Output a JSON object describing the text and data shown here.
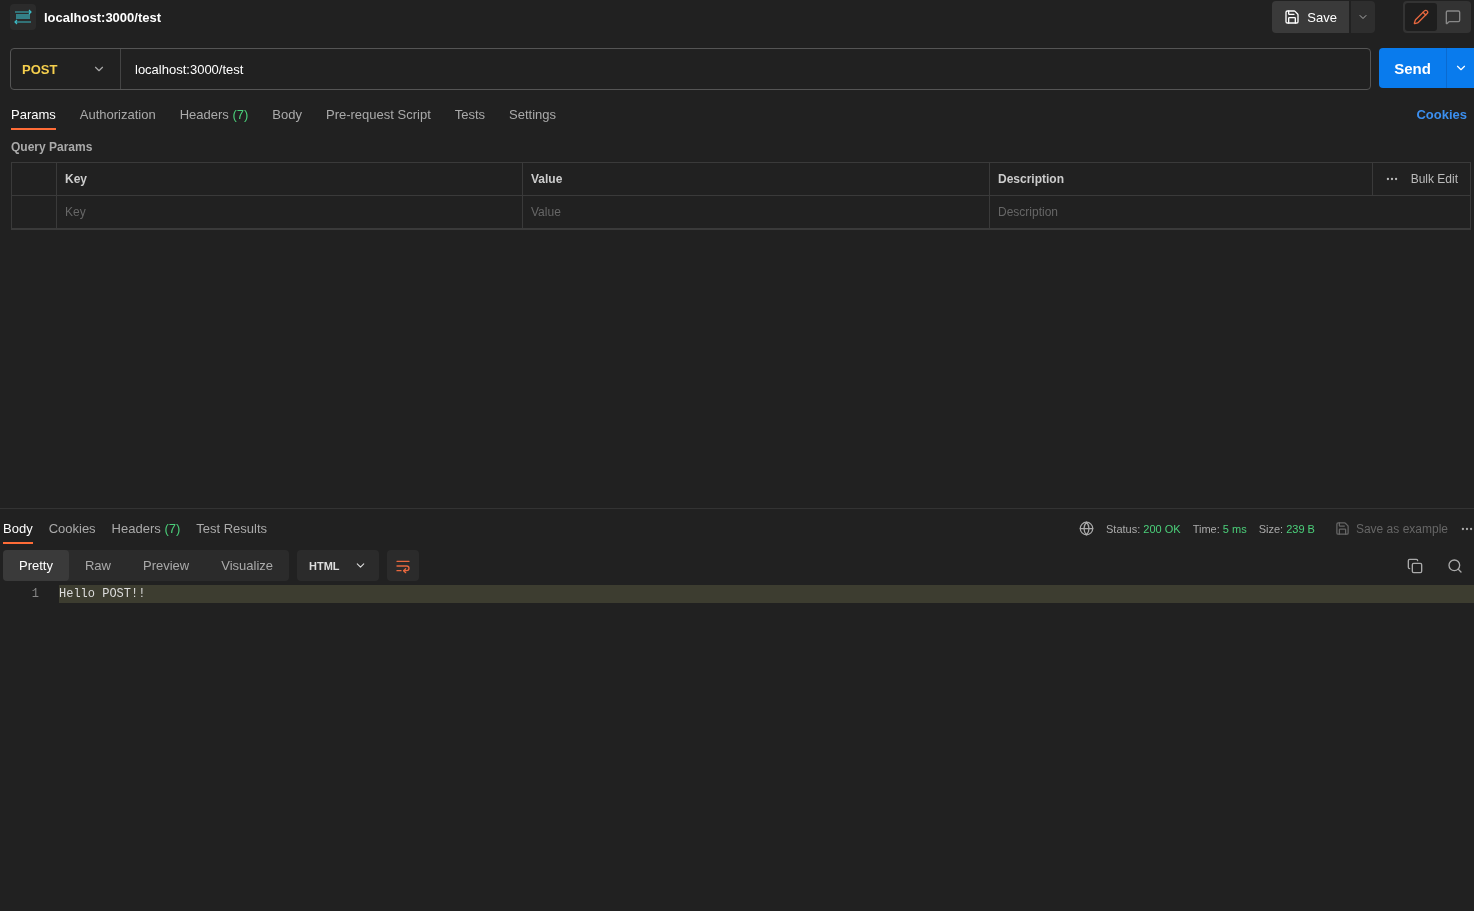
{
  "header": {
    "title": "localhost:3000/test",
    "save_label": "Save",
    "mode_toggle": [
      {
        "kind": "edit",
        "selected": true
      },
      {
        "kind": "comment",
        "selected": false
      }
    ]
  },
  "url_bar": {
    "method": "POST",
    "url": "localhost:3000/test",
    "send_label": "Send"
  },
  "request_tabs": [
    {
      "label": "Params",
      "selected": true
    },
    {
      "label": "Authorization",
      "selected": false
    },
    {
      "label": "Headers",
      "badge": "(7)",
      "selected": false
    },
    {
      "label": "Body",
      "selected": false
    },
    {
      "label": "Pre-request Script",
      "selected": false
    },
    {
      "label": "Tests",
      "selected": false
    },
    {
      "label": "Settings",
      "selected": false
    }
  ],
  "cookies_link": "Cookies",
  "query_params": {
    "title": "Query Params",
    "columns": [
      "Key",
      "Value",
      "Description"
    ],
    "bulk_edit": "Bulk Edit",
    "placeholders": [
      "Key",
      "Value",
      "Description"
    ]
  },
  "response": {
    "tabs": [
      {
        "label": "Body",
        "selected": true
      },
      {
        "label": "Cookies",
        "selected": false
      },
      {
        "label": "Headers",
        "badge": "(7)",
        "selected": false
      },
      {
        "label": "Test Results",
        "selected": false
      }
    ],
    "stats": [
      {
        "label": "Status:",
        "value": "200 OK"
      },
      {
        "label": "Time:",
        "value": "5 ms"
      },
      {
        "label": "Size:",
        "value": "239 B"
      }
    ],
    "save_example": "Save as example",
    "view_modes": [
      {
        "label": "Pretty",
        "selected": true
      },
      {
        "label": "Raw",
        "selected": false
      },
      {
        "label": "Preview",
        "selected": false
      },
      {
        "label": "Visualize",
        "selected": false
      }
    ],
    "language": "HTML",
    "lines": [
      {
        "number": "1",
        "text": "Hello POST!!",
        "highlighted": true
      }
    ]
  }
}
